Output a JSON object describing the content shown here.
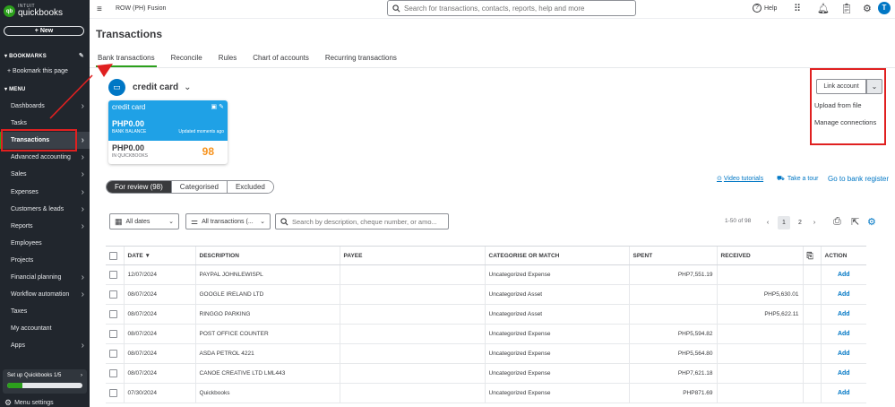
{
  "brand": {
    "intuit": "INTUIT",
    "name": "quickbooks",
    "mark": "qb"
  },
  "sidebar": {
    "new_label": "+ New",
    "bookmarks_label": "BOOKMARKS",
    "bookmark_page": "+  Bookmark this page",
    "menu_label": "MENU",
    "items": [
      {
        "label": "Dashboards",
        "arrow": true
      },
      {
        "label": "Tasks",
        "arrow": false
      },
      {
        "label": "Transactions",
        "arrow": true,
        "active": true
      },
      {
        "label": "Advanced accounting",
        "arrow": true
      },
      {
        "label": "Sales",
        "arrow": true
      },
      {
        "label": "Expenses",
        "arrow": true
      },
      {
        "label": "Customers & leads",
        "arrow": true
      },
      {
        "label": "Reports",
        "arrow": true
      },
      {
        "label": "Employees",
        "arrow": false
      },
      {
        "label": "Projects",
        "arrow": false
      },
      {
        "label": "Financial planning",
        "arrow": true
      },
      {
        "label": "Workflow automation",
        "arrow": true
      },
      {
        "label": "Taxes",
        "arrow": false
      },
      {
        "label": "My accountant",
        "arrow": false
      },
      {
        "label": "Apps",
        "arrow": true
      }
    ],
    "setup_label": "Set up Quickbooks 1/5",
    "setup_progress": 0.2,
    "menu_settings": "Menu settings"
  },
  "topbar": {
    "company": "ROW (PH) Fusion",
    "search_placeholder": "Search for transactions, contacts, reports, help and more",
    "help_label": "Help",
    "avatar_letter": "T"
  },
  "page": {
    "title": "Transactions",
    "tabs": [
      "Bank transactions",
      "Reconcile",
      "Rules",
      "Chart of accounts",
      "Recurring transactions"
    ]
  },
  "account": {
    "name": "credit card",
    "card_name": "credit card",
    "bank_balance": "PHP0.00",
    "bank_balance_label": "BANK BALANCE",
    "updated": "Updated moments ago",
    "qb_balance": "PHP0.00",
    "qb_balance_label": "IN QUICKBOOKS",
    "count": "98"
  },
  "link_menu": {
    "button": "Link account",
    "options": [
      "Upload from file",
      "Manage connections"
    ]
  },
  "filters": [
    "For review (98)",
    "Categorised",
    "Excluded"
  ],
  "links": {
    "video": "Video tutorials",
    "tour": "Take a tour",
    "register": "Go to bank register"
  },
  "controls": {
    "dates": "All dates",
    "transactions": "All transactions (...",
    "search_placeholder": "Search by description, cheque number, or amo..."
  },
  "pagination": {
    "range": "1-50 of 98",
    "pages": [
      "1",
      "2"
    ]
  },
  "table": {
    "headers": [
      "DATE ▼",
      "DESCRIPTION",
      "PAYEE",
      "CATEGORISE OR MATCH",
      "SPENT",
      "RECEIVED",
      "ACTION"
    ],
    "rows": [
      {
        "date": "12/07/2024",
        "description": "PAYPAL JOHNLEWISPL",
        "payee": "",
        "category": "Uncategorized Expense",
        "spent": "PHP7,551.19",
        "received": "",
        "action": "Add"
      },
      {
        "date": "08/07/2024",
        "description": "GOOGLE IRELAND LTD",
        "payee": "",
        "category": "Uncategorized Asset",
        "spent": "",
        "received": "PHP5,630.01",
        "action": "Add"
      },
      {
        "date": "08/07/2024",
        "description": "RINGGO PARKING",
        "payee": "",
        "category": "Uncategorized Asset",
        "spent": "",
        "received": "PHP5,622.11",
        "action": "Add"
      },
      {
        "date": "08/07/2024",
        "description": "POST OFFICE COUNTER",
        "payee": "",
        "category": "Uncategorized Expense",
        "spent": "PHP5,594.82",
        "received": "",
        "action": "Add"
      },
      {
        "date": "08/07/2024",
        "description": "ASDA PETROL 4221",
        "payee": "",
        "category": "Uncategorized Expense",
        "spent": "PHP5,564.80",
        "received": "",
        "action": "Add"
      },
      {
        "date": "08/07/2024",
        "description": "CANOE CREATIVE LTD LML443",
        "payee": "",
        "category": "Uncategorized Expense",
        "spent": "PHP7,621.18",
        "received": "",
        "action": "Add"
      },
      {
        "date": "07/30/2024",
        "description": "Quickbooks",
        "payee": "",
        "category": "Uncategorized Expense",
        "spent": "PHP871.69",
        "received": "",
        "action": "Add"
      }
    ]
  },
  "colors": {
    "accent": "#2ca01c",
    "link": "#0077c5",
    "highlight": "#e02020",
    "card": "#1fa1e6",
    "count": "#f7931e"
  }
}
